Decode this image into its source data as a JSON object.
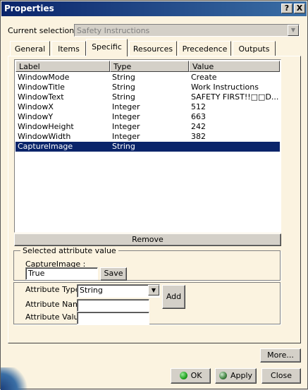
{
  "window": {
    "title": "Properties",
    "help_label": "?",
    "close_label": "X"
  },
  "selection": {
    "label": "Current selection :",
    "value": "Safety Instructions"
  },
  "tabs": [
    {
      "label": "General"
    },
    {
      "label": "Items"
    },
    {
      "label": "Specific"
    },
    {
      "label": "Resources"
    },
    {
      "label": "Precedence"
    },
    {
      "label": "Outputs"
    }
  ],
  "active_tab": "Specific",
  "table": {
    "headers": [
      "Label",
      "Type",
      "Value"
    ],
    "rows": [
      {
        "label": "WindowMode",
        "type": "String",
        "value": "Create"
      },
      {
        "label": "WindowTitle",
        "type": "String",
        "value": "Work Instructions"
      },
      {
        "label": "WindowText",
        "type": "String",
        "value": "SAFETY FIRST!!□□D..."
      },
      {
        "label": "WindowX",
        "type": "Integer",
        "value": "512"
      },
      {
        "label": "WindowY",
        "type": "Integer",
        "value": "663"
      },
      {
        "label": "WindowHeight",
        "type": "Integer",
        "value": "242"
      },
      {
        "label": "WindowWidth",
        "type": "Integer",
        "value": "382"
      },
      {
        "label": "CaptureImage",
        "type": "String",
        "value": ""
      }
    ],
    "selected_row": "CaptureImage"
  },
  "remove_label": "Remove",
  "selected_attr": {
    "group_label": "Selected attribute value",
    "field_label": "CaptureImage :",
    "value": "True",
    "save_label": "Save"
  },
  "new_attr": {
    "type_label": "Attribute Type",
    "type_value": "String",
    "name_label": "Attribute Name",
    "name_value": "",
    "value_label": "Attribute Value",
    "value_value": "",
    "add_label": "Add"
  },
  "footer": {
    "more_label": "More...",
    "ok_label": "OK",
    "apply_label": "Apply",
    "close_label": "Close"
  },
  "colors": {
    "selection": "#0a246a",
    "ok_dot": "#1fa31f",
    "apply_dot": "#1f7a1f"
  }
}
